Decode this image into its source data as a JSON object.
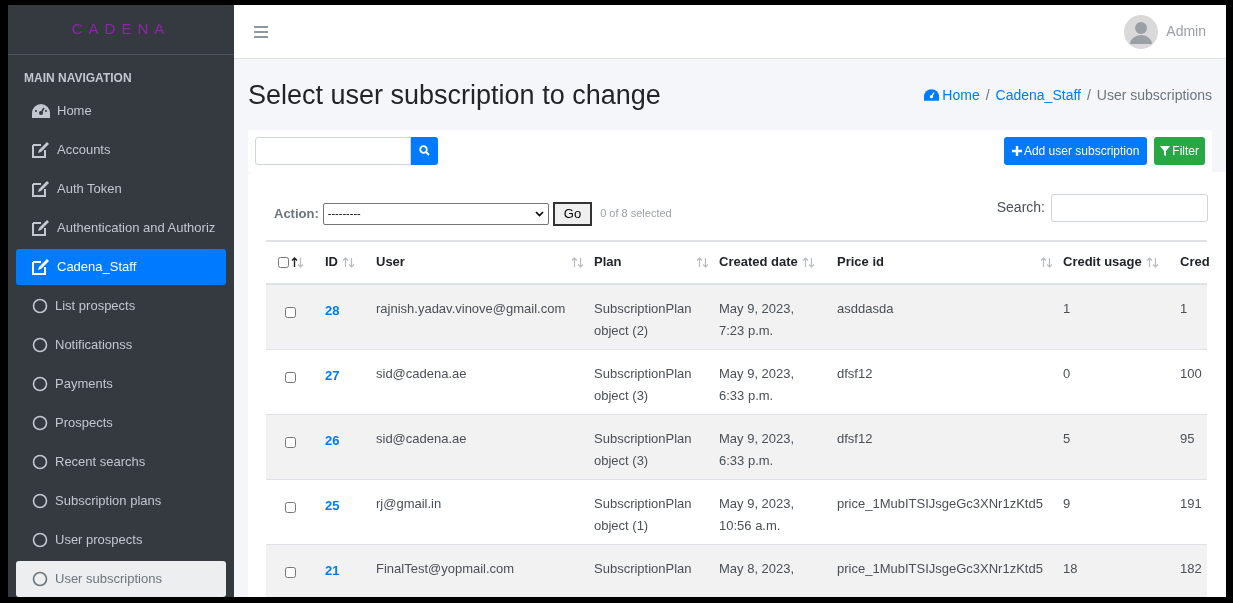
{
  "brand": "CADENA",
  "sidebar": {
    "header": "MAIN NAVIGATION",
    "items": [
      {
        "label": "Home",
        "kind": "dashboard",
        "selected": false,
        "current": false
      },
      {
        "label": "Accounts",
        "kind": "edit",
        "selected": false,
        "current": false
      },
      {
        "label": "Auth Token",
        "kind": "edit",
        "selected": false,
        "current": false
      },
      {
        "label": "Authentication and Authoriz",
        "kind": "edit",
        "selected": false,
        "current": false
      },
      {
        "label": "Cadena_Staff",
        "kind": "edit",
        "selected": true,
        "current": false
      },
      {
        "label": "List prospects",
        "kind": "circle",
        "selected": false,
        "current": false
      },
      {
        "label": "Notificationss",
        "kind": "circle",
        "selected": false,
        "current": false
      },
      {
        "label": "Payments",
        "kind": "circle",
        "selected": false,
        "current": false
      },
      {
        "label": "Prospects",
        "kind": "circle",
        "selected": false,
        "current": false
      },
      {
        "label": "Recent searchs",
        "kind": "circle",
        "selected": false,
        "current": false
      },
      {
        "label": "Subscription plans",
        "kind": "circle",
        "selected": false,
        "current": false
      },
      {
        "label": "User prospects",
        "kind": "circle",
        "selected": false,
        "current": false
      },
      {
        "label": "User subscriptions",
        "kind": "circle",
        "selected": false,
        "current": true
      }
    ]
  },
  "topbar": {
    "user": "Admin"
  },
  "page_title": "Select user subscription to change",
  "breadcrumb": {
    "items": [
      "Home",
      "Cadena_Staff",
      "User subscriptions"
    ],
    "separators": [
      "/",
      "/"
    ]
  },
  "buttons": {
    "add": "Add user subscription",
    "filter": "Filter"
  },
  "actions": {
    "label": "Action:",
    "value": "---------",
    "go": "Go",
    "selection_count": "0 of 8 selected"
  },
  "search": {
    "label": "Search:"
  },
  "table": {
    "select_all_checked": false,
    "columns": [
      "ID",
      "User",
      "Plan",
      "Created date",
      "Price id",
      "Credit usage",
      "Cred"
    ],
    "rows": [
      {
        "checked": false,
        "cells": [
          "28",
          "rajnish.yadav.vinove@gmail.com",
          "SubscriptionPlan object (2)",
          "May 9, 2023, 7:23 p.m.",
          "asddasda",
          "1",
          "1"
        ]
      },
      {
        "checked": false,
        "cells": [
          "27",
          "sid@cadena.ae",
          "SubscriptionPlan object (3)",
          "May 9, 2023, 6:33 p.m.",
          "dfsf12",
          "0",
          "100"
        ]
      },
      {
        "checked": false,
        "cells": [
          "26",
          "sid@cadena.ae",
          "SubscriptionPlan object (3)",
          "May 9, 2023, 6:33 p.m.",
          "dfsf12",
          "5",
          "95"
        ]
      },
      {
        "checked": false,
        "cells": [
          "25",
          "rj@gmail.in",
          "SubscriptionPlan object (1)",
          "May 9, 2023, 10:56 a.m.",
          "price_1MubITSIJsgeGc3XNr1zKtd5",
          "9",
          "191"
        ]
      },
      {
        "checked": false,
        "cells": [
          "21",
          "FinalTest@yopmail.com",
          "SubscriptionPlan",
          "May 8, 2023,",
          "price_1MubITSIJsgeGc3XNr1zKtd5",
          "18",
          "182"
        ]
      }
    ]
  }
}
